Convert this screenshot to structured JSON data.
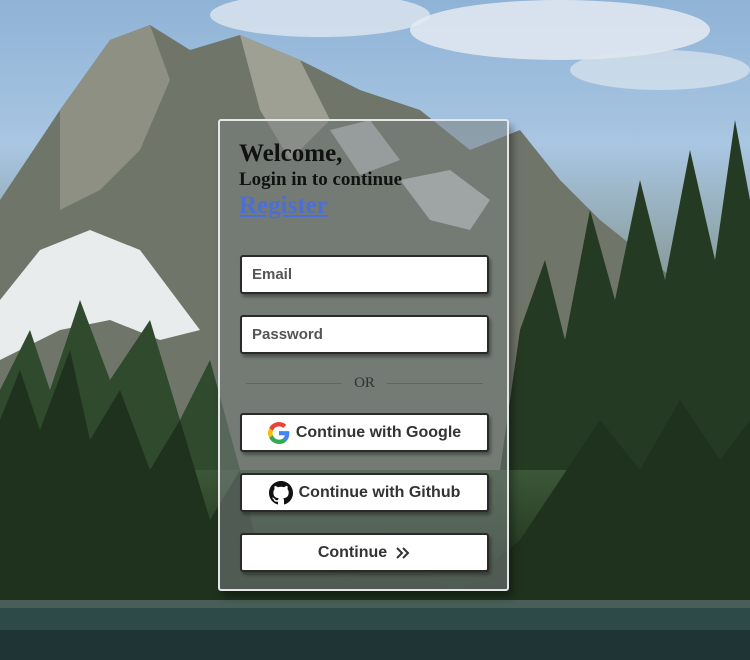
{
  "login": {
    "title": "Welcome,",
    "subtitle": "Login in to continue",
    "register_link": "Register",
    "email_placeholder": "Email",
    "password_placeholder": "Password",
    "divider_text": "OR",
    "google_button": "Continue with Google",
    "github_button": "Continue with Github",
    "continue_button": "Continue"
  },
  "icons": {
    "google": "google-logo-icon",
    "github": "github-logo-icon",
    "continue": "double-chevron-right-icon"
  },
  "colors": {
    "link": "#4b6fd6",
    "card_border": "#e4e6e8",
    "button_border": "#2a2a2a"
  }
}
